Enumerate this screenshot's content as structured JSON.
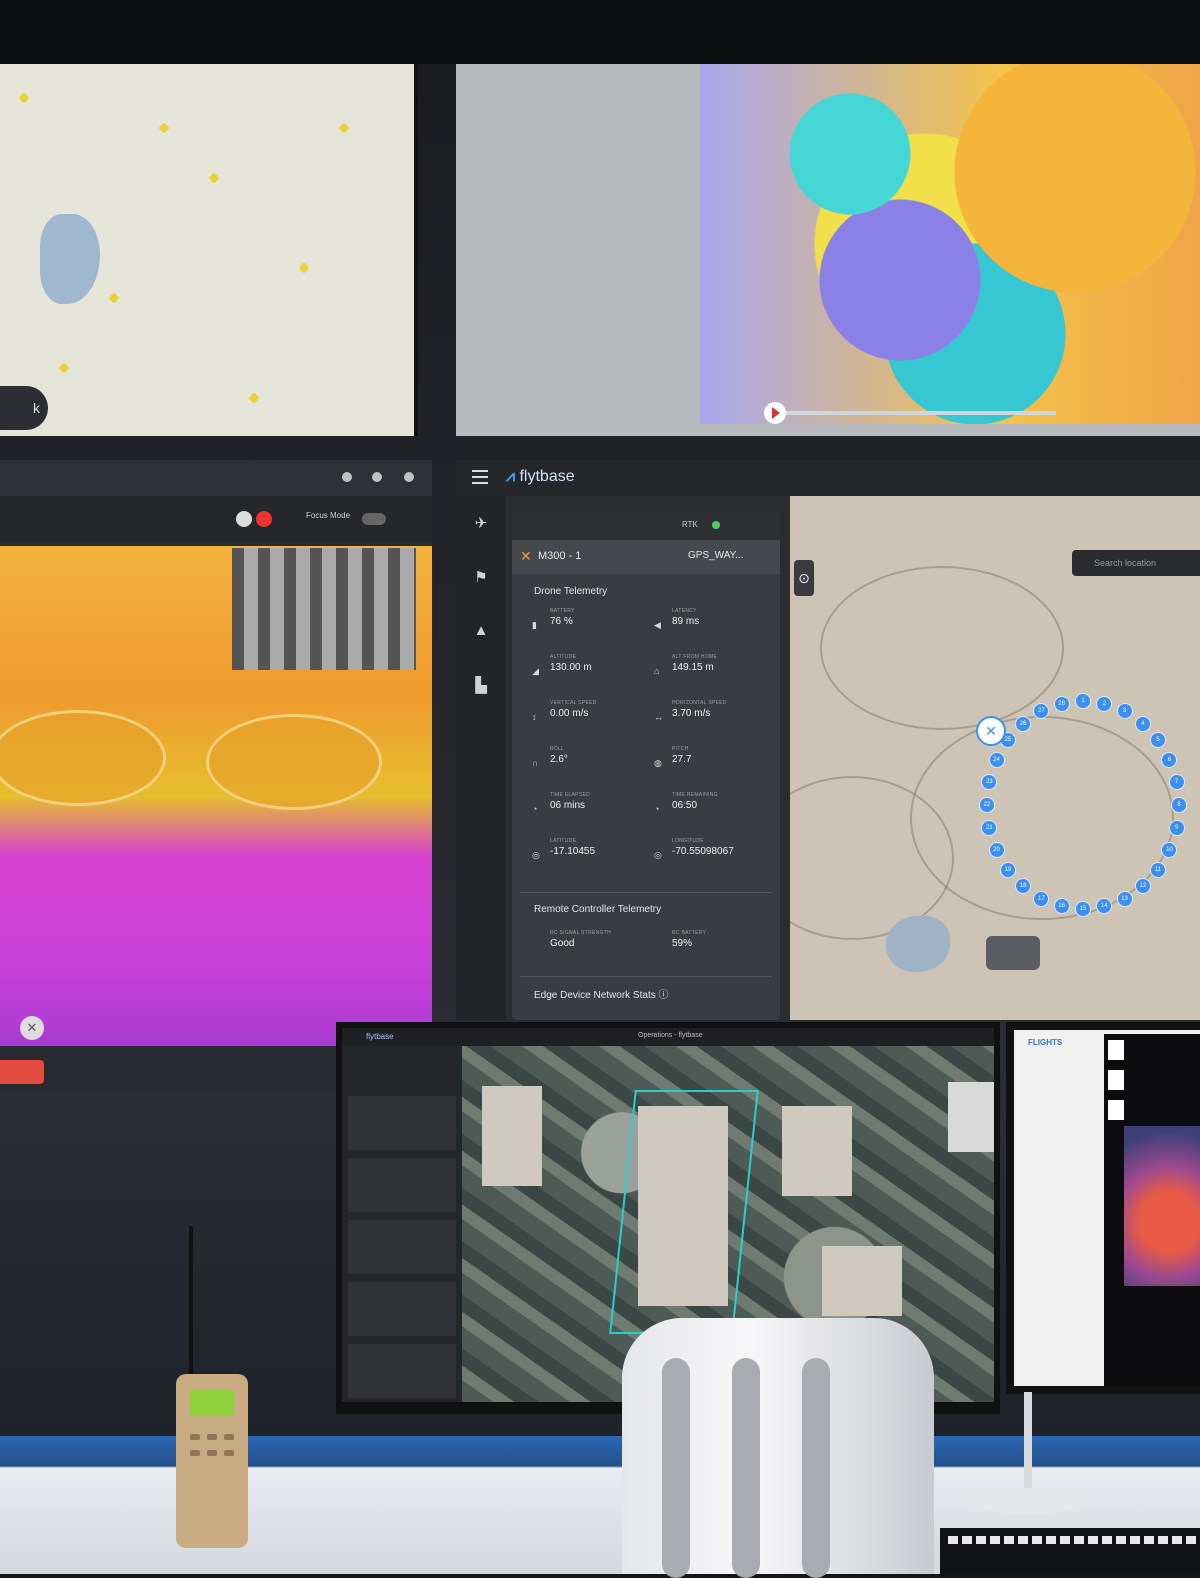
{
  "weather_screen": {
    "colors": {
      "cyan": "#46d6d6",
      "yellow": "#f2e04a",
      "orange": "#f3b43a",
      "purple": "#8b80e6"
    }
  },
  "thermal_screen": {
    "mode_label": "Focus Mode",
    "accent": "#e24b3d"
  },
  "flytbase": {
    "logo": "flytbase",
    "header_status": "RTK",
    "drone_name": "M300 - 1",
    "flight_mode": "GPS_WAY...",
    "drone_telemetry_title": "Drone Telemetry",
    "fields": [
      {
        "key": "BATTERY",
        "value": "76 %"
      },
      {
        "key": "LATENCY",
        "value": "89 ms"
      },
      {
        "key": "ALTITUDE",
        "value": "130.00 m"
      },
      {
        "key": "ALT FROM HOME",
        "value": "149.15 m"
      },
      {
        "key": "VERTICAL SPEED",
        "value": "0.00 m/s"
      },
      {
        "key": "HORIZONTAL SPEED",
        "value": "3.70 m/s"
      },
      {
        "key": "ROLL",
        "value": "2.6°"
      },
      {
        "key": "PITCH",
        "value": "27.7"
      },
      {
        "key": "TIME ELAPSED",
        "value": "06 mins"
      },
      {
        "key": "TIME REMAINING",
        "value": "06:50"
      },
      {
        "key": "LATITUDE",
        "value": "-17.10455"
      },
      {
        "key": "LONGITUDE",
        "value": "-70.55098067"
      }
    ],
    "remote_title": "Remote Controller Telemetry",
    "remote_fields": [
      {
        "key": "RC SIGNAL STRENGTH",
        "value": "Good"
      },
      {
        "key": "RC BATTERY",
        "value": "59%"
      }
    ],
    "edge_title": "Edge Device Network Stats",
    "search_placeholder": "Search location",
    "waypoints": [
      "1",
      "2",
      "3",
      "4",
      "5",
      "6",
      "7",
      "8",
      "9",
      "10",
      "11",
      "12",
      "13",
      "14",
      "15",
      "16",
      "17",
      "18",
      "19",
      "20",
      "21",
      "22",
      "23",
      "24",
      "25",
      "26",
      "27",
      "28"
    ]
  },
  "monitor_left": {
    "logo": "flytbase",
    "title": "Operations - flytbase"
  },
  "monitor_right": {
    "brand": "FLIGHTS"
  },
  "map_screen": {
    "pill_label": "k"
  }
}
